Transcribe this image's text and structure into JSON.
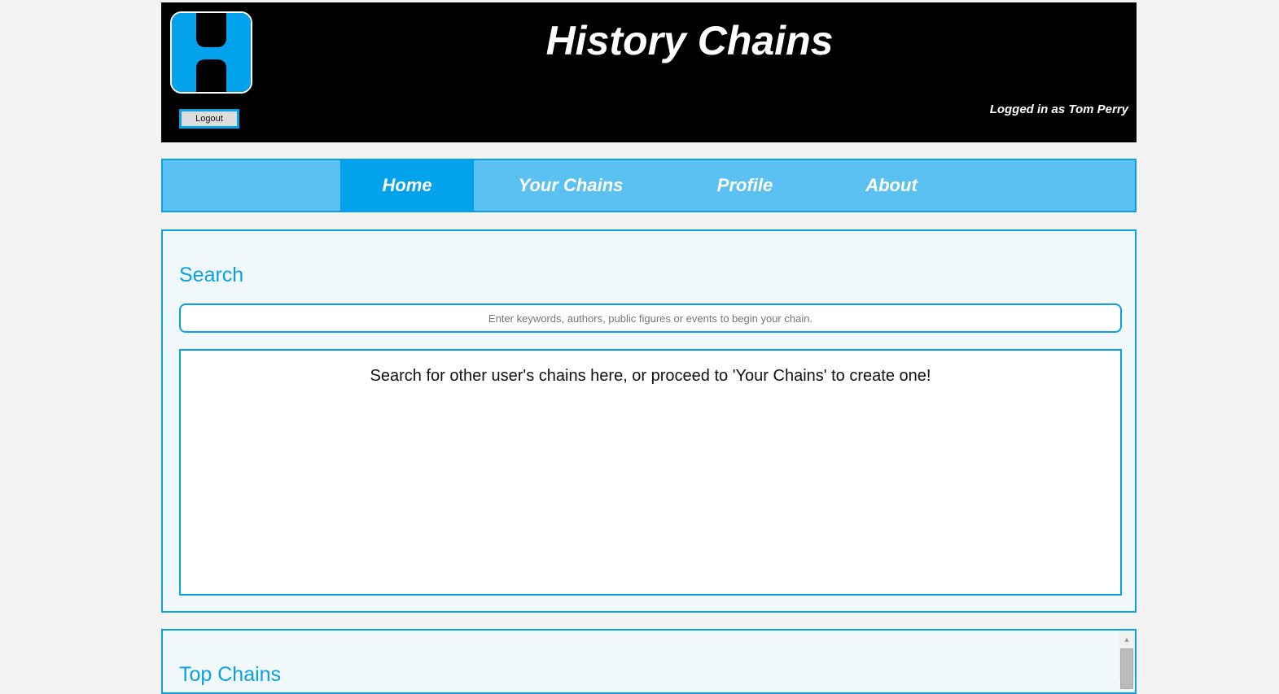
{
  "header": {
    "title": "History Chains",
    "logout_label": "Logout",
    "logged_in": "Logged in as Tom Perry",
    "logo_letter": "H"
  },
  "nav": {
    "items": [
      {
        "label": "Home",
        "active": true
      },
      {
        "label": "Your Chains"
      },
      {
        "label": "Profile"
      },
      {
        "label": "About"
      }
    ]
  },
  "search": {
    "heading": "Search",
    "placeholder": "Enter keywords, authors, public figures or events to begin your chain.",
    "results_message": "Search for other user's chains here, or proceed to 'Your Chains' to create one!"
  },
  "top_chains": {
    "heading": "Top Chains"
  },
  "colors": {
    "accent": "#0aa0e8",
    "nav_bg": "#5bc0f2",
    "header_bg": "#000000"
  }
}
